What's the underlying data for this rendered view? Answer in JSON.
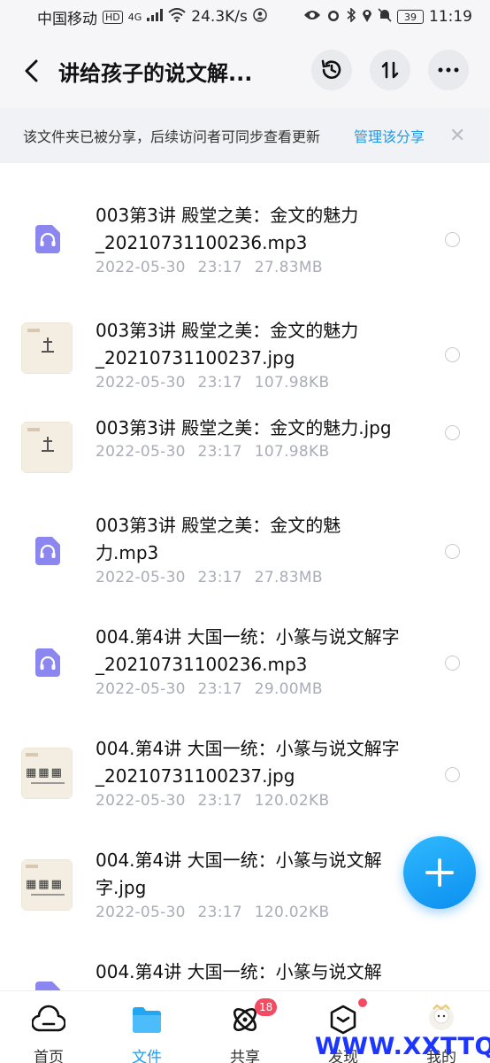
{
  "status_bar": {
    "carrier": "中国移动",
    "hd": "HD",
    "net": "4G",
    "speed": "24.3K/s",
    "battery": "39",
    "time": "11:19"
  },
  "header": {
    "title": "讲给孩子的说文解...",
    "history_icon": "history-icon",
    "sort_icon": "sort-icon",
    "more_icon": "more-icon"
  },
  "share_bar": {
    "text": "该文件夹已被分享，后续访问者可同步查看更新",
    "manage": "管理该分享",
    "close": "✕"
  },
  "files": [
    {
      "type": "audio",
      "name": "003第3讲 殿堂之美：金文的魅力_20210731100236.mp3",
      "date": "2022-05-30",
      "time": "23:17",
      "size": "27.83MB"
    },
    {
      "type": "image",
      "name": "003第3讲 殿堂之美：金文的魅力_20210731100237.jpg",
      "date": "2022-05-30",
      "time": "23:17",
      "size": "107.98KB"
    },
    {
      "type": "image",
      "name": "003第3讲 殿堂之美：金文的魅力.jpg",
      "date": "2022-05-30",
      "time": "23:17",
      "size": "107.98KB"
    },
    {
      "type": "audio",
      "name": "003第3讲 殿堂之美：金文的魅力.mp3",
      "date": "2022-05-30",
      "time": "23:17",
      "size": "27.83MB"
    },
    {
      "type": "audio",
      "name": "004.第4讲 大国一统：小篆与说文解字_20210731100236.mp3",
      "date": "2022-05-30",
      "time": "23:17",
      "size": "29.00MB"
    },
    {
      "type": "image",
      "name": "004.第4讲 大国一统：小篆与说文解字_20210731100237.jpg",
      "date": "2022-05-30",
      "time": "23:17",
      "size": "120.02KB"
    },
    {
      "type": "image",
      "name": "004.第4讲 大国一统：小篆与说文解字.jpg",
      "date": "2022-05-30",
      "time": "23:17",
      "size": "120.02KB"
    },
    {
      "type": "audio",
      "name": "004.第4讲 大国一统：小篆与说文解",
      "date": "",
      "time": "",
      "size": ""
    }
  ],
  "nav": {
    "home": "首页",
    "files": "文件",
    "share": "共享",
    "share_badge": "18",
    "discover": "发现",
    "me": "我的"
  },
  "colors": {
    "accent": "#1d9cf0",
    "audio_icon": "#8b86f0",
    "badge": "#f24b62"
  },
  "watermark": "WWW.XXTTQ.COM"
}
